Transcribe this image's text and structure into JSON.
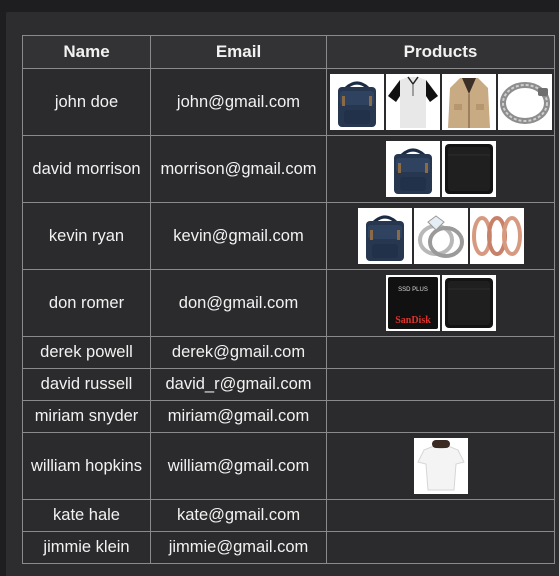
{
  "table": {
    "headers": [
      "Name",
      "Email",
      "Products"
    ],
    "rows": [
      {
        "name": "john doe",
        "email": "john@gmail.com",
        "products": [
          "backpack-product-icon",
          "henley-shirt-product-icon",
          "jacket-product-icon",
          "bracelet-product-icon"
        ]
      },
      {
        "name": "david morrison",
        "email": "morrison@gmail.com",
        "products": [
          "backpack-product-icon",
          "hard-drive-product-icon"
        ]
      },
      {
        "name": "kevin ryan",
        "email": "kevin@gmail.com",
        "products": [
          "backpack-product-icon",
          "diamond-ring-product-icon",
          "rose-gold-rings-product-icon"
        ]
      },
      {
        "name": "don romer",
        "email": "don@gmail.com",
        "products": [
          "sandisk-ssd-product-icon",
          "hard-drive-product-icon"
        ]
      },
      {
        "name": "derek powell",
        "email": "derek@gmail.com",
        "products": []
      },
      {
        "name": "david russell",
        "email": "david_r@gmail.com",
        "products": []
      },
      {
        "name": "miriam snyder",
        "email": "miriam@gmail.com",
        "products": []
      },
      {
        "name": "william hopkins",
        "email": "william@gmail.com",
        "products": [
          "white-tshirt-product-icon"
        ]
      },
      {
        "name": "kate hale",
        "email": "kate@gmail.com",
        "products": []
      },
      {
        "name": "jimmie klein",
        "email": "jimmie@gmail.com",
        "products": []
      }
    ]
  },
  "ssd_label": {
    "line1": "SSD PLUS",
    "brand": "SanDisk"
  },
  "colors": {
    "page_bg": "#1e1e20",
    "panel_bg": "#2d2d2f",
    "border": "#8a8a8c",
    "text": "#f2f2f2"
  }
}
